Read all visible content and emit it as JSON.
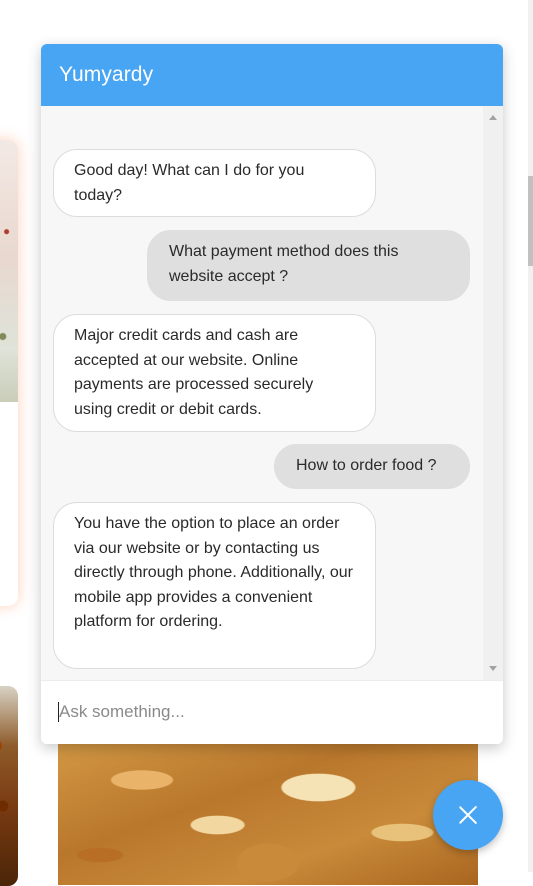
{
  "chat": {
    "title": "Yumyardy",
    "messages": [
      {
        "role": "bot",
        "text": "Good day! What can I do for you today?"
      },
      {
        "role": "user",
        "text": "What payment method does this website accept ?"
      },
      {
        "role": "bot",
        "text": "Major credit cards and cash are accepted at our website. Online payments are processed securely using credit or debit cards."
      },
      {
        "role": "user",
        "text": "How to order food ?"
      },
      {
        "role": "bot",
        "text": "You have the option to place an order via our website or by contacting us directly through phone. Additionally, our mobile app provides a convenient platform for ordering."
      }
    ],
    "input": {
      "placeholder": "Ask something...",
      "value": ""
    },
    "close_icon": "close-icon"
  },
  "colors": {
    "accent": "#47a5f4",
    "bot_bubble": "#ffffff",
    "user_bubble": "#dfdfdf"
  }
}
